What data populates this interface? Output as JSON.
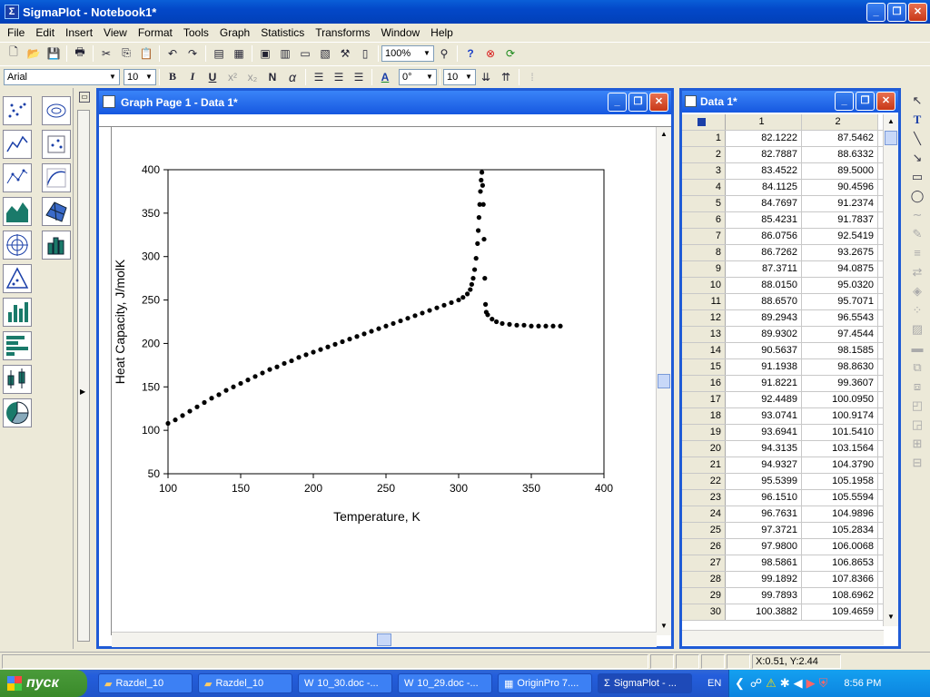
{
  "app": {
    "title": "SigmaPlot - Notebook1*",
    "logo": "Σ"
  },
  "window_buttons": {
    "minimize": "_",
    "restore": "❐",
    "close": "✕"
  },
  "menu": [
    "File",
    "Edit",
    "Insert",
    "View",
    "Format",
    "Tools",
    "Graph",
    "Statistics",
    "Transforms",
    "Window",
    "Help"
  ],
  "toolbar": {
    "zoom": "100%",
    "font": "Arial",
    "font_size": "10",
    "bold": "B",
    "italic": "I",
    "underline": "U",
    "normal": "N",
    "alpha": "α",
    "rotation": "0°",
    "line_size": "10"
  },
  "graph_window": {
    "title": "Graph Page 1 - Data 1*"
  },
  "data_window": {
    "title": "Data 1*"
  },
  "chart_data": {
    "type": "scatter",
    "xlabel": "Temperature, K",
    "ylabel": "Heat Capacity, J/molK",
    "xlim": [
      100,
      400
    ],
    "ylim": [
      50,
      400
    ],
    "xticks": [
      100,
      150,
      200,
      250,
      300,
      350,
      400
    ],
    "yticks": [
      50,
      100,
      150,
      200,
      250,
      300,
      350,
      400
    ],
    "grid": false,
    "series": [
      {
        "values": [
          [
            100,
            108
          ],
          [
            105,
            112
          ],
          [
            110,
            117
          ],
          [
            115,
            122
          ],
          [
            120,
            127
          ],
          [
            125,
            132
          ],
          [
            130,
            137
          ],
          [
            135,
            141
          ],
          [
            140,
            146
          ],
          [
            145,
            150
          ],
          [
            150,
            154
          ],
          [
            155,
            158
          ],
          [
            160,
            162
          ],
          [
            165,
            166
          ],
          [
            170,
            170
          ],
          [
            175,
            173
          ],
          [
            180,
            177
          ],
          [
            185,
            180
          ],
          [
            190,
            184
          ],
          [
            195,
            187
          ],
          [
            200,
            190
          ],
          [
            205,
            193
          ],
          [
            210,
            196
          ],
          [
            215,
            199
          ],
          [
            220,
            202
          ],
          [
            225,
            205
          ],
          [
            230,
            208
          ],
          [
            235,
            211
          ],
          [
            240,
            214
          ],
          [
            245,
            217
          ],
          [
            250,
            220
          ],
          [
            255,
            223
          ],
          [
            260,
            226
          ],
          [
            265,
            229
          ],
          [
            270,
            232
          ],
          [
            275,
            235
          ],
          [
            280,
            238
          ],
          [
            285,
            241
          ],
          [
            290,
            244
          ],
          [
            295,
            247
          ],
          [
            300,
            250
          ],
          [
            303,
            253
          ],
          [
            306,
            257
          ],
          [
            308,
            262
          ],
          [
            309,
            268
          ],
          [
            310,
            275
          ],
          [
            311,
            285
          ],
          [
            312,
            298
          ],
          [
            313,
            315
          ],
          [
            313.5,
            330
          ],
          [
            314,
            345
          ],
          [
            314.5,
            360
          ],
          [
            315,
            375
          ],
          [
            315.5,
            388
          ],
          [
            316,
            397
          ],
          [
            316.5,
            382
          ],
          [
            317,
            360
          ],
          [
            317.5,
            320
          ],
          [
            318,
            275
          ],
          [
            318.5,
            245
          ],
          [
            319,
            236
          ],
          [
            320,
            233
          ],
          [
            323,
            228
          ],
          [
            326,
            225
          ],
          [
            330,
            223
          ],
          [
            335,
            222
          ],
          [
            340,
            221
          ],
          [
            345,
            221
          ],
          [
            350,
            220
          ],
          [
            355,
            220
          ],
          [
            360,
            220
          ],
          [
            365,
            220
          ],
          [
            370,
            220
          ]
        ]
      }
    ]
  },
  "table": {
    "col_headers": [
      "1",
      "2"
    ],
    "rows": [
      [
        "1",
        "82.1222",
        "87.5462"
      ],
      [
        "2",
        "82.7887",
        "88.6332"
      ],
      [
        "3",
        "83.4522",
        "89.5000"
      ],
      [
        "4",
        "84.1125",
        "90.4596"
      ],
      [
        "5",
        "84.7697",
        "91.2374"
      ],
      [
        "6",
        "85.4231",
        "91.7837"
      ],
      [
        "7",
        "86.0756",
        "92.5419"
      ],
      [
        "8",
        "86.7262",
        "93.2675"
      ],
      [
        "9",
        "87.3711",
        "94.0875"
      ],
      [
        "10",
        "88.0150",
        "95.0320"
      ],
      [
        "11",
        "88.6570",
        "95.7071"
      ],
      [
        "12",
        "89.2943",
        "96.5543"
      ],
      [
        "13",
        "89.9302",
        "97.4544"
      ],
      [
        "14",
        "90.5637",
        "98.1585"
      ],
      [
        "15",
        "91.1938",
        "98.8630"
      ],
      [
        "16",
        "91.8221",
        "99.3607"
      ],
      [
        "17",
        "92.4489",
        "100.0950"
      ],
      [
        "18",
        "93.0741",
        "100.9174"
      ],
      [
        "19",
        "93.6941",
        "101.5410"
      ],
      [
        "20",
        "94.3135",
        "103.1564"
      ],
      [
        "21",
        "94.9327",
        "104.3790"
      ],
      [
        "22",
        "95.5399",
        "105.1958"
      ],
      [
        "23",
        "96.1510",
        "105.5594"
      ],
      [
        "24",
        "96.7631",
        "104.9896"
      ],
      [
        "25",
        "97.3721",
        "105.2834"
      ],
      [
        "26",
        "97.9800",
        "106.0068"
      ],
      [
        "27",
        "98.5861",
        "106.8653"
      ],
      [
        "28",
        "99.1892",
        "107.8366"
      ],
      [
        "29",
        "99.7893",
        "108.6962"
      ],
      [
        "30",
        "100.3882",
        "109.4659"
      ]
    ]
  },
  "status": {
    "coords": "X:0.51, Y:2.44"
  },
  "taskbar": {
    "start": "пуск",
    "tasks": [
      "Razdel_10",
      "Razdel_10",
      "10_30.doc -...",
      "10_29.doc -...",
      "OriginPro 7....",
      "SigmaPlot - ..."
    ],
    "lang": "EN",
    "clock": "8:56 PM"
  }
}
